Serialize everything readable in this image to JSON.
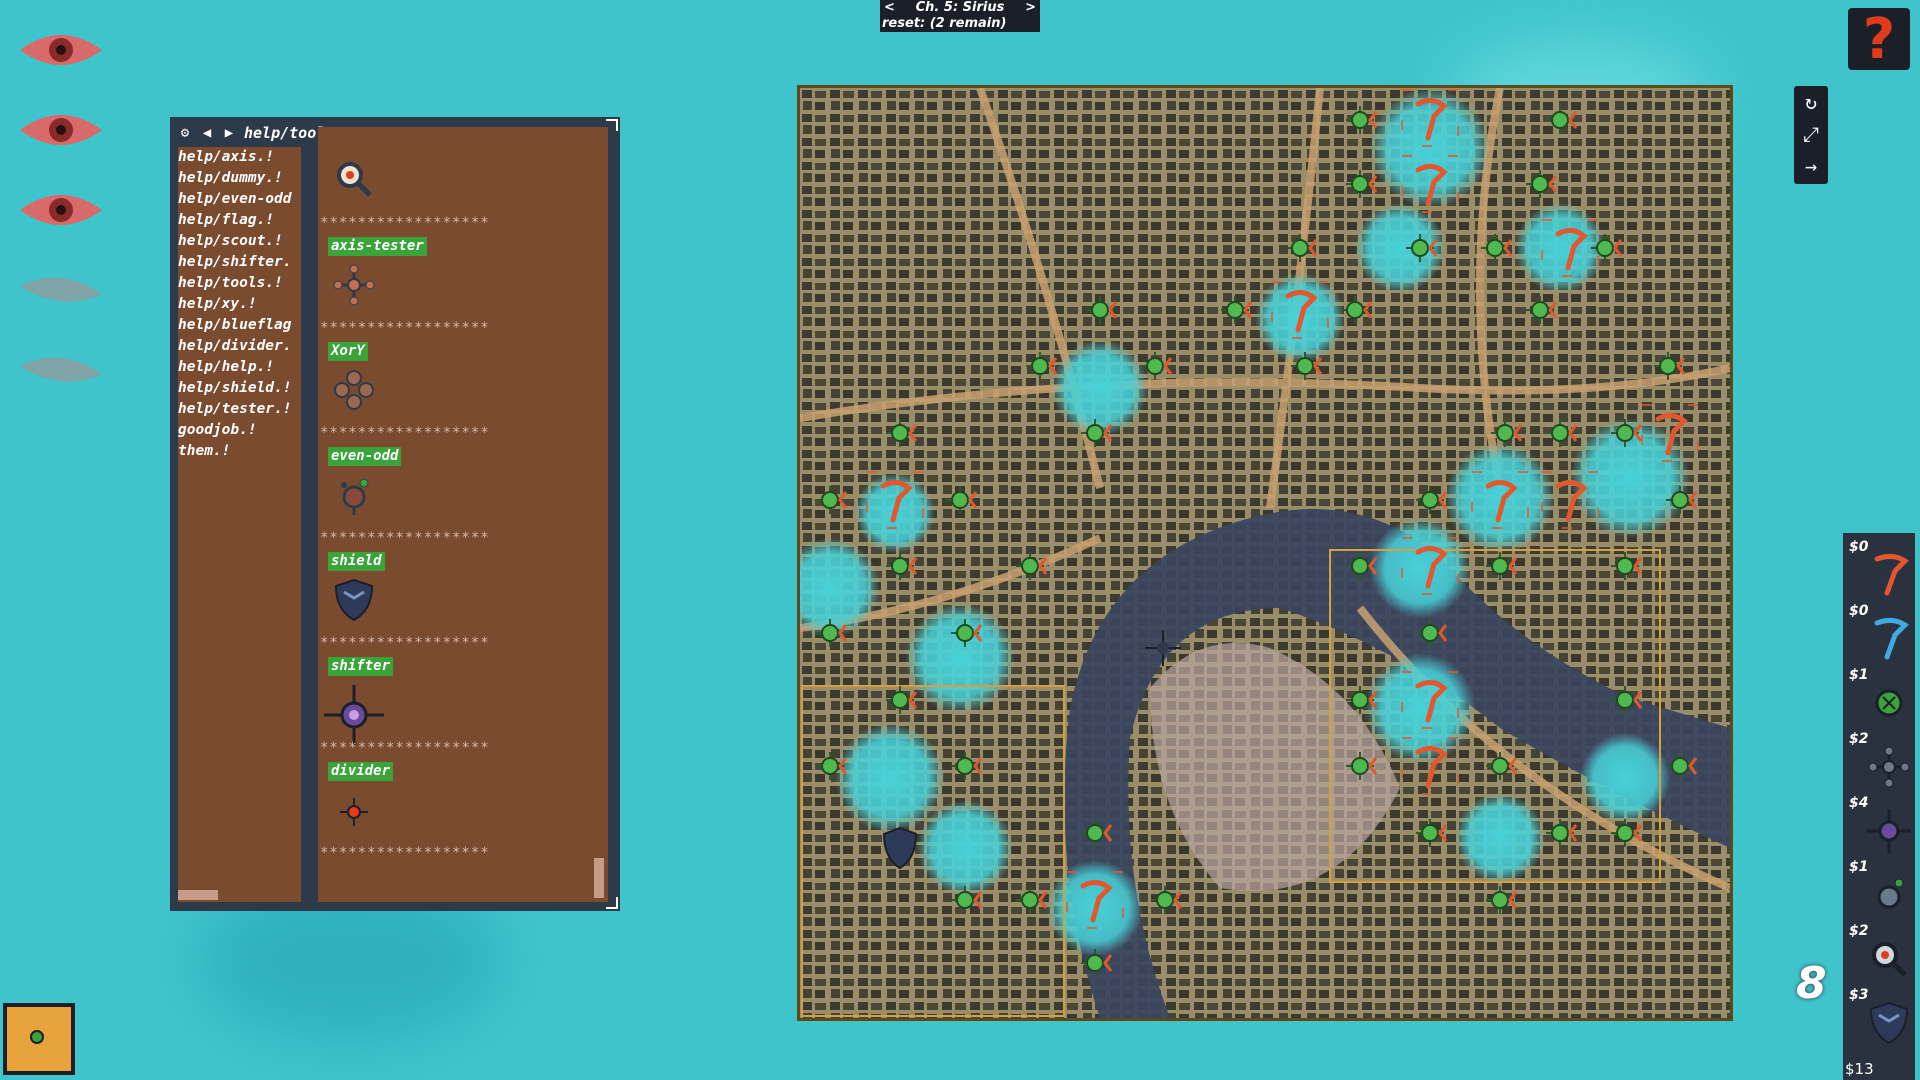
{
  "chapter": {
    "prev": "<",
    "title": "Ch. 5: Sirius",
    "next": ">",
    "reset": "reset: (2 remain)"
  },
  "help_button": "?",
  "terminal": {
    "path": "help/tools.!",
    "files": [
      "help/axis.!",
      "help/dummy.!",
      "help/even-odd",
      "help/flag.!",
      "help/scout.!",
      "help/shifter.",
      "help/tools.!",
      "help/xy.!",
      "help/blueflag",
      "help/divider.",
      "help/help.!",
      "help/shield.!",
      "help/tester.!",
      "goodjob.!",
      "them.!"
    ],
    "separator": "******************",
    "tools": [
      {
        "name": "axis-tester",
        "icon": "cross-node-icon"
      },
      {
        "name": "XorY",
        "icon": "diamond-node-icon"
      },
      {
        "name": "even-odd",
        "icon": "bug-node-icon"
      },
      {
        "name": "shield",
        "icon": "shield-icon"
      },
      {
        "name": "shifter",
        "icon": "shifter-icon"
      },
      {
        "name": "divider",
        "icon": "divider-icon"
      }
    ]
  },
  "eyes": [
    "eye-open",
    "eye-open",
    "eye-open",
    "eye-closed",
    "eye-closed"
  ],
  "shop": {
    "items": [
      {
        "price": "$0",
        "icon": "red-flag-icon",
        "color": "#e2572d"
      },
      {
        "price": "$0",
        "icon": "blue-flag-icon",
        "color": "#3fa9e0"
      },
      {
        "price": "$1",
        "icon": "scout-icon",
        "color": "#3aa33a"
      },
      {
        "price": "$2",
        "icon": "cross-node-icon",
        "color": "#2d3a4a"
      },
      {
        "price": "$4",
        "icon": "shifter-icon",
        "color": "#6a4a9a"
      },
      {
        "price": "$1",
        "icon": "even-odd-icon",
        "color": "#3aa33a"
      },
      {
        "price": "$2",
        "icon": "tester-icon",
        "color": "#e03c1c"
      },
      {
        "price": "$3",
        "icon": "shield-icon",
        "color": "#2d3a5a"
      }
    ],
    "total": "$13"
  },
  "flags_remaining": "8",
  "colors": {
    "sea": "#3fc4cc",
    "panel": "#2d3a4a",
    "terminal_bg": "#7a4b2e",
    "tag": "#3aa33a",
    "flag": "#e2572d",
    "accent": "#e8a23c"
  }
}
